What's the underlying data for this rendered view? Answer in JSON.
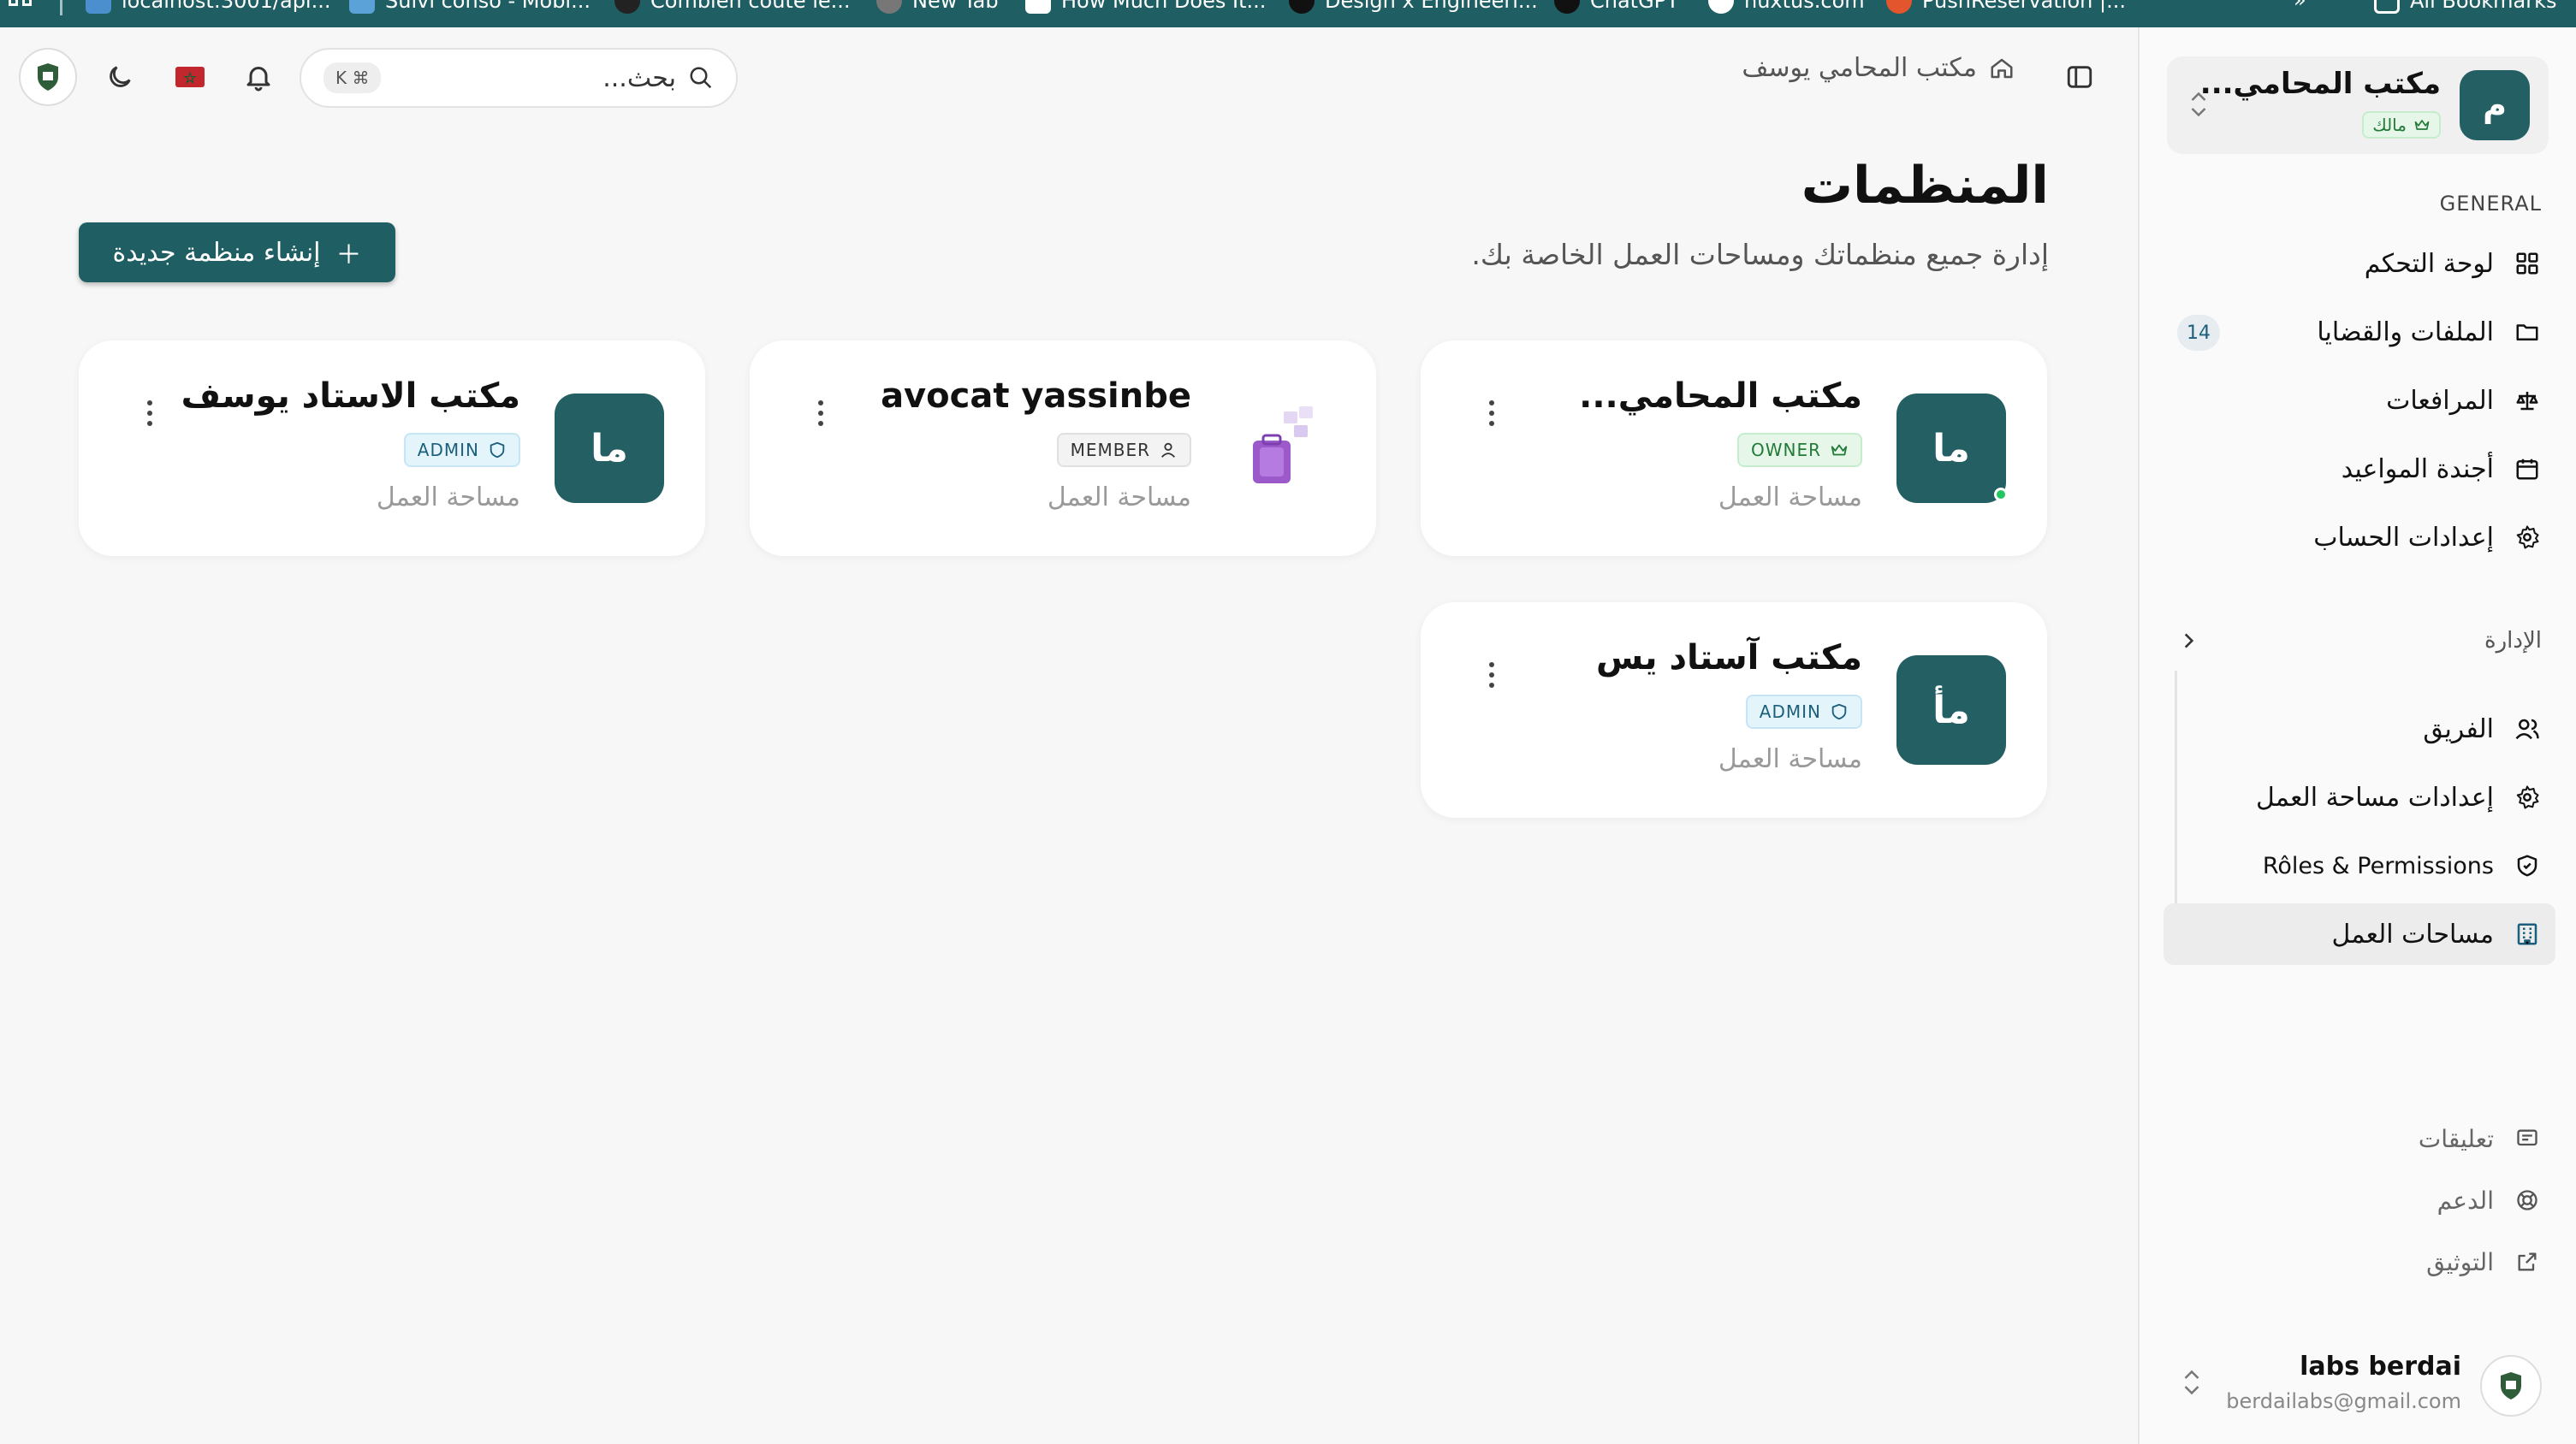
{
  "bookmarks": {
    "items": [
      {
        "label": "localhost:3001/api...",
        "color": "#4b8fcf"
      },
      {
        "label": "Suivi conso - Mobi...",
        "color": "#5aa2d8"
      },
      {
        "label": "Combien coûte le...",
        "color": "#222222"
      },
      {
        "label": "New Tab",
        "color": "#777777"
      },
      {
        "label": "How Much Does It...",
        "color": "#ffffff"
      },
      {
        "label": "Design x Engineeri...",
        "color": "#111111"
      },
      {
        "label": "ChatGPT",
        "color": "#111111"
      },
      {
        "label": "nuxtus.com",
        "color": "#ffffff"
      },
      {
        "label": "PushReservation |...",
        "color": "#e2552d"
      }
    ],
    "all_bookmarks": "All Bookmarks"
  },
  "header": {
    "breadcrumb_home": "مكتب المحامي يوسف",
    "search_placeholder": "بحث...",
    "search_shortcut": "⌘ K"
  },
  "page": {
    "title": "المنظمات",
    "subtitle": "إدارة جميع منظماتك ومساحات العمل الخاصة بك.",
    "create_button": "إنشاء منظمة جديدة"
  },
  "orgs": [
    {
      "name": "مكتب المحامي...",
      "avatar": "ما",
      "role": "OWNER",
      "type": "مساحة العمل",
      "online": true
    },
    {
      "name": "avocat yassinbe",
      "avatar": "image",
      "role": "MEMBER",
      "type": "مساحة العمل"
    },
    {
      "name": "مكتب الاستاد يوسف",
      "avatar": "ما",
      "role": "ADMIN",
      "type": "مساحة العمل"
    },
    {
      "name": "مكتب آستاد يس",
      "avatar": "مأ",
      "role": "ADMIN",
      "type": "مساحة العمل"
    }
  ],
  "sidebar": {
    "workspace": {
      "name": "مكتب المحامي...",
      "avatar": "م",
      "role": "مالك"
    },
    "general_label": "GENERAL",
    "general_items": [
      {
        "label": "لوحة التحكم",
        "icon": "grid-icon"
      },
      {
        "label": "الملفات والقضايا",
        "icon": "folder-icon",
        "count": "14"
      },
      {
        "label": "المرافعات",
        "icon": "scale-icon"
      },
      {
        "label": "أجندة المواعيد",
        "icon": "calendar-icon"
      },
      {
        "label": "إعدادات الحساب",
        "icon": "gear-icon"
      }
    ],
    "admin_label": "الإدارة",
    "admin_items": [
      {
        "label": "الفريق",
        "icon": "users-icon"
      },
      {
        "label": "إعدادات مساحة العمل",
        "icon": "gear-icon"
      },
      {
        "label": "Rôles & Permissions",
        "icon": "shield-icon"
      },
      {
        "label": "مساحات العمل",
        "icon": "building-icon",
        "active": true
      }
    ],
    "footer_items": [
      {
        "label": "تعليقات",
        "icon": "message-icon"
      },
      {
        "label": "الدعم",
        "icon": "lifebuoy-icon"
      },
      {
        "label": "التوثيق",
        "icon": "external-link-icon"
      }
    ],
    "user": {
      "name": "labs berdai",
      "email": "berdailabs@gmail.com"
    }
  },
  "colors": {
    "brand": "#1f5e62",
    "avatar": "#245f63",
    "owner_green": "#227a38",
    "admin_blue": "#1b5f7d"
  }
}
